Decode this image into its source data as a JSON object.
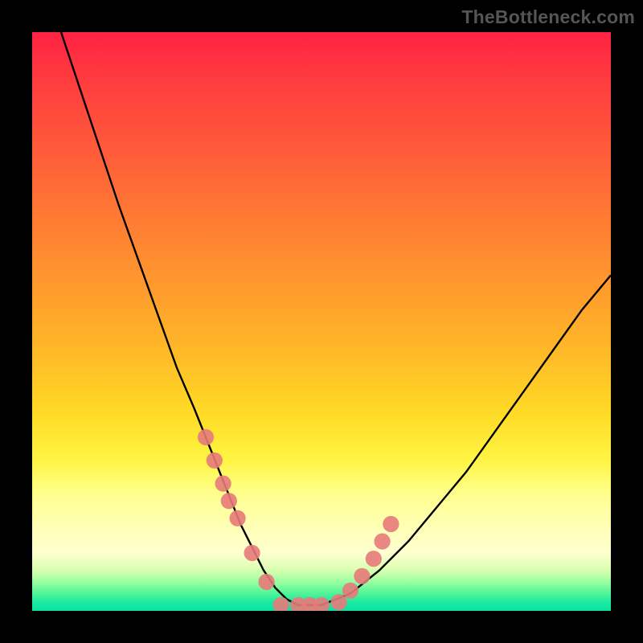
{
  "watermark": "TheBottleneck.com",
  "chart_data": {
    "type": "line",
    "title": "",
    "xlabel": "",
    "ylabel": "",
    "xlim": [
      0,
      100
    ],
    "ylim": [
      0,
      100
    ],
    "background_gradient": {
      "orientation": "vertical",
      "stops": [
        {
          "pos": 0,
          "color": "#ff2244"
        },
        {
          "pos": 20,
          "color": "#ff5a3a"
        },
        {
          "pos": 44,
          "color": "#ff9a2d"
        },
        {
          "pos": 66,
          "color": "#ffdb26"
        },
        {
          "pos": 80,
          "color": "#ffff90"
        },
        {
          "pos": 95,
          "color": "#9affa0"
        },
        {
          "pos": 100,
          "color": "#07e3a3"
        }
      ]
    },
    "series": [
      {
        "name": "bottleneck-curve",
        "color": "#000000",
        "x": [
          5,
          10,
          15,
          20,
          25,
          28,
          30,
          32,
          34,
          36,
          38,
          40,
          42,
          44,
          46,
          48,
          50,
          55,
          60,
          65,
          70,
          75,
          80,
          85,
          90,
          95,
          100
        ],
        "y": [
          100,
          85,
          70,
          56,
          42,
          35,
          30,
          25,
          20,
          15,
          11,
          7,
          4,
          2,
          1,
          1,
          1,
          3,
          7,
          12,
          18,
          24,
          31,
          38,
          45,
          52,
          58
        ]
      }
    ],
    "markers": {
      "name": "data-points",
      "color": "#e77a7a",
      "radius_pct": 1.4,
      "x": [
        30,
        31.5,
        33,
        34,
        35.5,
        38,
        40.5,
        43,
        46,
        48,
        50,
        53,
        55,
        57,
        59,
        60.5,
        62
      ],
      "y": [
        30,
        26,
        22,
        19,
        16,
        10,
        5,
        1,
        1,
        1,
        1,
        1.5,
        3.5,
        6,
        9,
        12,
        15
      ]
    }
  }
}
